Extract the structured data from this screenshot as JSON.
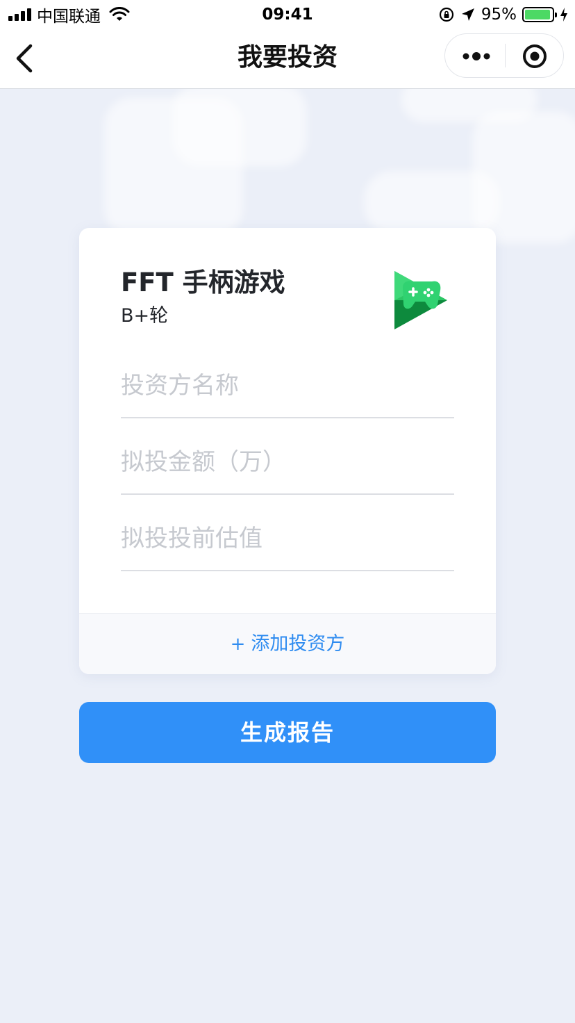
{
  "status_bar": {
    "carrier": "中国联通",
    "time": "09:41",
    "battery_percent": "95%",
    "battery_level": 0.95,
    "icons": [
      "signal-icon",
      "wifi-icon",
      "orientation-lock-icon",
      "location-arrow-icon",
      "battery-icon",
      "charging-icon"
    ]
  },
  "nav": {
    "title": "我要投资",
    "back_icon": "chevron-left-icon",
    "more_icon": "more-dots-icon",
    "close_icon": "miniprogram-close-icon"
  },
  "card": {
    "company_name": "FFT 手柄游戏",
    "round": "B+轮",
    "logo_icon": "game-controller-play-icon",
    "fields": [
      {
        "placeholder": "投资方名称"
      },
      {
        "placeholder": "拟投金额（万）"
      },
      {
        "placeholder": "拟投投前估值"
      }
    ],
    "add_investor": {
      "plus": "+",
      "label": "添加投资方"
    }
  },
  "submit_label": "生成报告",
  "colors": {
    "accent": "#3090f8",
    "link": "#2f8cf0",
    "background": "#ebeff8",
    "logo_green_light": "#3fd97a",
    "logo_green_dark": "#0d8a3d"
  }
}
